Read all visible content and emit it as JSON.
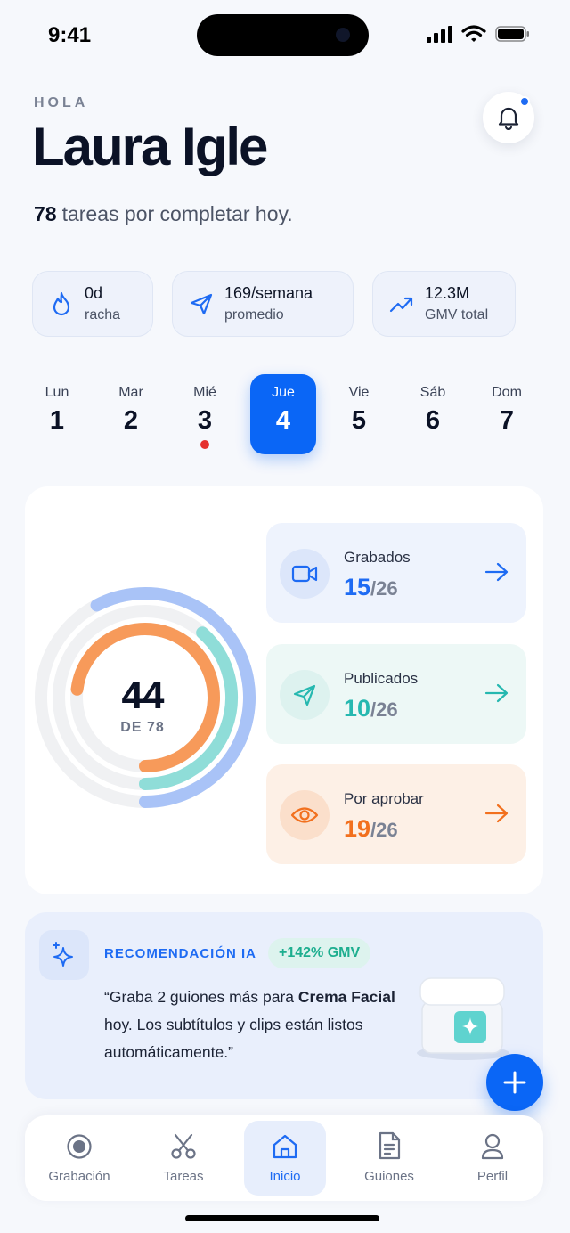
{
  "status_bar": {
    "time": "9:41"
  },
  "header": {
    "greeting": "HOLA",
    "name": "Laura Igle",
    "tasks_count": "78",
    "tasks_text": "tareas por completar hoy."
  },
  "stats": [
    {
      "value": "0d",
      "label": "racha",
      "icon": "flame-icon"
    },
    {
      "value": "169/semana",
      "label": "promedio",
      "icon": "send-icon"
    },
    {
      "value": "12.3M",
      "label": "GMV total",
      "icon": "trend-up-icon"
    }
  ],
  "week": [
    {
      "name": "Lun",
      "num": "1"
    },
    {
      "name": "Mar",
      "num": "2"
    },
    {
      "name": "Mié",
      "num": "3",
      "has_event": true
    },
    {
      "name": "Jue",
      "num": "4",
      "selected": true
    },
    {
      "name": "Vie",
      "num": "5"
    },
    {
      "name": "Sáb",
      "num": "6"
    },
    {
      "name": "Dom",
      "num": "7"
    }
  ],
  "progress": {
    "total_done": "44",
    "total_label": "DE 78",
    "rings": [
      {
        "name": "Grabados",
        "fraction": 0.577,
        "color": "#A9C3F7"
      },
      {
        "name": "Publicados",
        "fraction": 0.385,
        "color": "#8FDDD8"
      },
      {
        "name": "Por aprobar",
        "fraction": 0.731,
        "color": "#F79A5A"
      }
    ]
  },
  "metrics": [
    {
      "label": "Grabados",
      "value": "15",
      "total": "/26",
      "accent": "#1E6BF3",
      "bg": "#EEF3FD",
      "icon_bg": "#DCE6FA",
      "icon": "video-camera-icon"
    },
    {
      "label": "Publicados",
      "value": "10",
      "total": "/26",
      "accent": "#26B8B0",
      "bg": "#EDF8F6",
      "icon_bg": "#DDF2EF",
      "icon": "send-icon"
    },
    {
      "label": "Por aprobar",
      "value": "19",
      "total": "/26",
      "accent": "#F2701E",
      "bg": "#FDF0E6",
      "icon_bg": "#FBDFCB",
      "icon": "eye-icon"
    }
  ],
  "ai": {
    "title": "RECOMENDACIÓN IA",
    "badge": "+142% GMV",
    "text_1": "“Graba 2 guiones más para ",
    "text_bold": "Crema Facial",
    "text_2": " hoy. Los subtítulos y clips están listos automáticamente.”"
  },
  "tabs": [
    {
      "label": "Grabación",
      "icon": "record-icon"
    },
    {
      "label": "Tareas",
      "icon": "scissors-icon"
    },
    {
      "label": "Inicio",
      "icon": "home-icon",
      "active": true
    },
    {
      "label": "Guiones",
      "icon": "document-icon"
    },
    {
      "label": "Perfil",
      "icon": "user-icon"
    }
  ]
}
